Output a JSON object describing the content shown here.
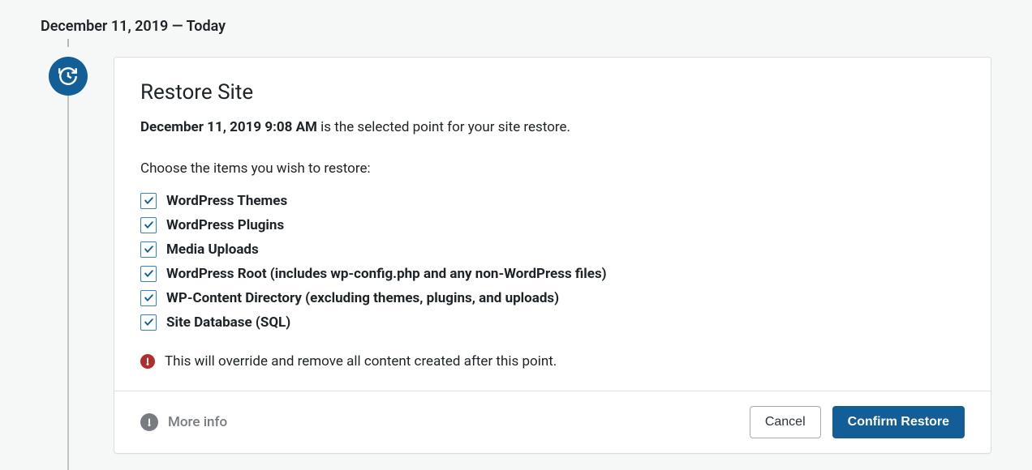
{
  "header": {
    "date_heading": "December 11, 2019 — Today"
  },
  "card": {
    "title": "Restore Site",
    "timestamp": "December 11, 2019 9:08 AM",
    "desc_suffix": " is the selected point for your site restore.",
    "choose_label": "Choose the items you wish to restore:",
    "options": [
      {
        "label": "WordPress Themes"
      },
      {
        "label": "WordPress Plugins"
      },
      {
        "label": "Media Uploads"
      },
      {
        "label": "WordPress Root (includes wp-config.php and any non-WordPress files)"
      },
      {
        "label": "WP-Content Directory (excluding themes, plugins, and uploads)"
      },
      {
        "label": "Site Database (SQL)"
      }
    ],
    "warning_text": "This will override and remove all content created after this point."
  },
  "footer": {
    "more_info_label": "More info",
    "cancel_label": "Cancel",
    "confirm_label": "Confirm Restore"
  },
  "colors": {
    "primary": "#135e96",
    "danger": "#b32d2e",
    "muted": "#787c82"
  }
}
